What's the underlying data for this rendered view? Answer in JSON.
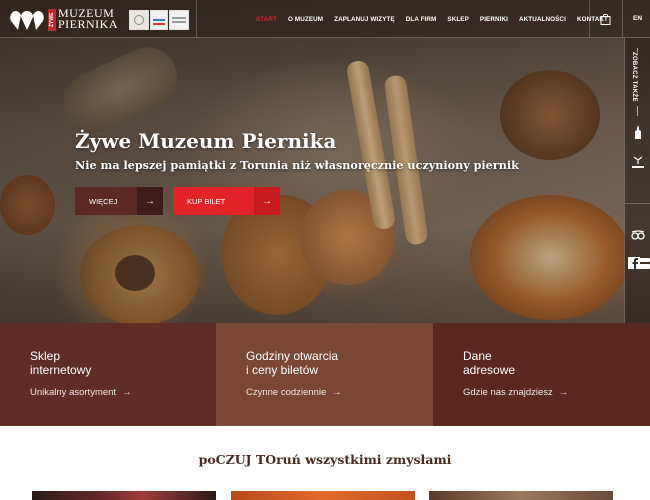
{
  "brand": {
    "logo_line1": "MUZEUM",
    "logo_line2": "PIERNIKA",
    "logo_side": "ŻYWE"
  },
  "nav": {
    "items": [
      "START",
      "O MUZEUM",
      "ZAPLANUJ WIZYTĘ",
      "DLA FIRM",
      "SKLEP",
      "PIERNIKI",
      "AKTUALNOŚCI",
      "KONTAKT"
    ],
    "active_index": 0,
    "lang": "EN"
  },
  "sidebar": {
    "label": "ZOBACZ TAKŻE"
  },
  "hero": {
    "title": "Żywe Muzeum Piernika",
    "subtitle": "Nie ma lepszej pamiątki z Torunia niż własnoręcznie uczyniony piernik",
    "btn_more": "WIĘCEJ",
    "btn_ticket": "KUP BILET",
    "arrow": "→"
  },
  "tiles": [
    {
      "title_line1": "Sklep",
      "title_line2": "internetowy",
      "link": "Unikalny asortyment"
    },
    {
      "title_line1": "Godziny otwarcia",
      "title_line2": "i ceny biletów",
      "link": "Czynne codziennie"
    },
    {
      "title_line1": "Dane",
      "title_line2": "adresowe",
      "link": "Gdzie nas znajdziesz"
    }
  ],
  "tagline": "poCZUJ TOruń wszystkimi zmysłami",
  "colors": {
    "accent_red": "#e2232a",
    "tile_dark": "#5f2d25",
    "tile_mid": "#7a4636"
  }
}
